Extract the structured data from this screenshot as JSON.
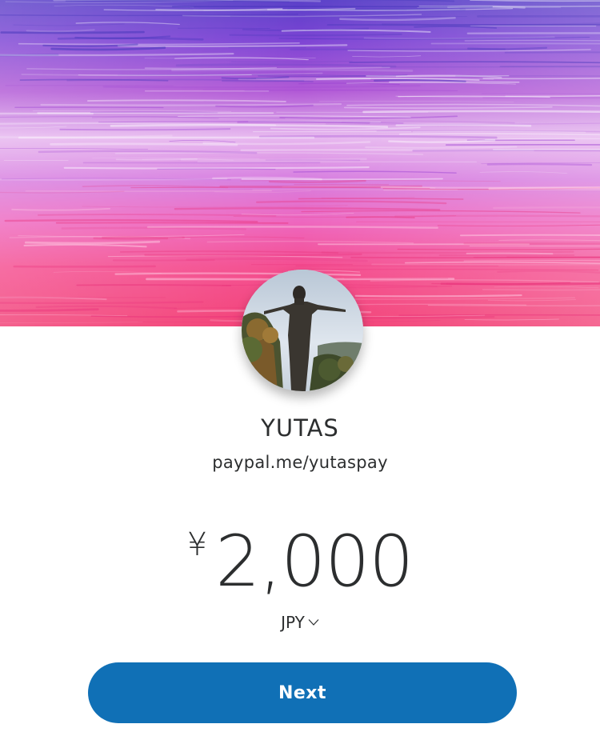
{
  "profile": {
    "name": "YUTAS",
    "handle": "paypal.me/yutaspay"
  },
  "payment": {
    "currency_symbol": "¥",
    "amount": "2,000",
    "currency_code": "JPY"
  },
  "actions": {
    "next_label": "Next"
  },
  "colors": {
    "primary_button": "#1070b6",
    "text": "#2c2e2f",
    "cover_top": "#6b46d0",
    "cover_bottom": "#f53a78"
  },
  "icons": {
    "currency_dropdown": "chevron-down-icon"
  }
}
